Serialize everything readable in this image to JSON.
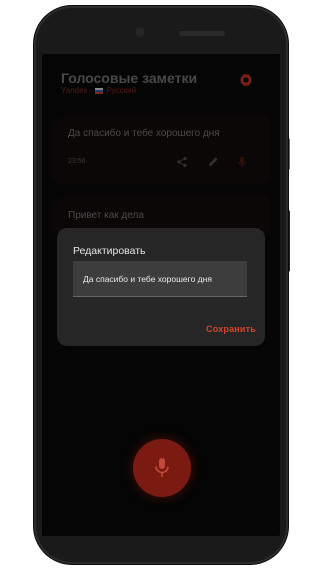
{
  "app": {
    "title": "Голосовые заметки",
    "subtitle_prefix": "Yandex ·",
    "language": "Русский"
  },
  "notes": [
    {
      "text": "Да спасибо и тебе хорошего дня",
      "time": "23:56"
    },
    {
      "text": "Привет как дела"
    }
  ],
  "dialog": {
    "title": "Редактировать",
    "value": "Да спасибо и тебе хорошего дня",
    "save_label": "Сохранить"
  },
  "icons": {
    "settings": "gear-icon",
    "share": "share-icon",
    "edit": "pencil-icon",
    "record": "mic-icon"
  },
  "colors": {
    "accent": "#d2452b",
    "dialog_bg": "#262626",
    "screen_bg": "#090909"
  }
}
